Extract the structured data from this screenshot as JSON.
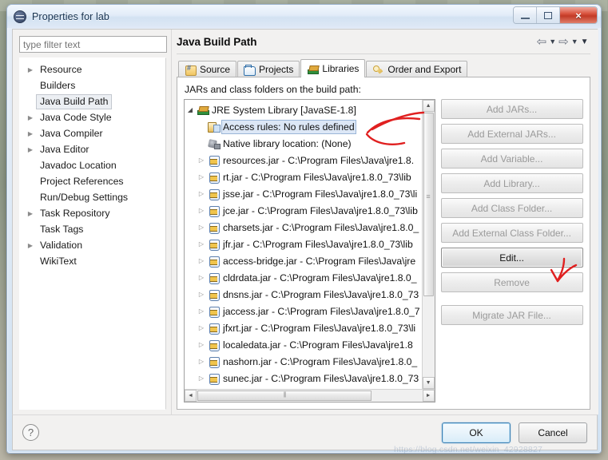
{
  "window": {
    "title": "Properties for lab",
    "logo_icon": "eclipse-logo",
    "controls": {
      "minimize": "minimize-icon",
      "maximize": "maximize-icon",
      "close": "×"
    }
  },
  "sidebar": {
    "filter": {
      "placeholder": "type filter text",
      "value": ""
    },
    "items": [
      {
        "label": "Resource",
        "expandable": true,
        "selected": false
      },
      {
        "label": "Builders",
        "expandable": false,
        "selected": false
      },
      {
        "label": "Java Build Path",
        "expandable": false,
        "selected": true
      },
      {
        "label": "Java Code Style",
        "expandable": true,
        "selected": false
      },
      {
        "label": "Java Compiler",
        "expandable": true,
        "selected": false
      },
      {
        "label": "Java Editor",
        "expandable": true,
        "selected": false
      },
      {
        "label": "Javadoc Location",
        "expandable": false,
        "selected": false
      },
      {
        "label": "Project References",
        "expandable": false,
        "selected": false
      },
      {
        "label": "Run/Debug Settings",
        "expandable": false,
        "selected": false
      },
      {
        "label": "Task Repository",
        "expandable": true,
        "selected": false
      },
      {
        "label": "Task Tags",
        "expandable": false,
        "selected": false
      },
      {
        "label": "Validation",
        "expandable": true,
        "selected": false
      },
      {
        "label": "WikiText",
        "expandable": false,
        "selected": false
      }
    ]
  },
  "page": {
    "title": "Java Build Path",
    "nav": {
      "back_icon": "arrow-left-icon",
      "back_menu_icon": "chevron-down-icon",
      "forward_icon": "arrow-right-icon",
      "forward_menu_icon": "chevron-down-icon",
      "menu_icon": "chevron-down-filled-icon"
    },
    "tabs": [
      {
        "label": "Source",
        "icon": "source-folder-icon",
        "active": false
      },
      {
        "label": "Projects",
        "icon": "project-folder-icon",
        "active": false
      },
      {
        "label": "Libraries",
        "icon": "libraries-icon",
        "active": true
      },
      {
        "label": "Order and Export",
        "icon": "order-export-icon",
        "active": false
      }
    ],
    "panel_label": "JARs and class folders on the build path:",
    "panel_label_mnemonic": "h"
  },
  "jar_tree": [
    {
      "label": "JRE System Library [JavaSE-1.8]",
      "icon": "jre-library-icon",
      "twisty": "expanded",
      "indent": 0,
      "selected": false
    },
    {
      "label": "Access rules: No rules defined",
      "icon": "access-rules-icon",
      "twisty": "none",
      "indent": 1,
      "selected": true
    },
    {
      "label": "Native library location: (None)",
      "icon": "native-library-icon",
      "twisty": "none",
      "indent": 1,
      "selected": false
    },
    {
      "label": "resources.jar - C:\\Program Files\\Java\\jre1.8.",
      "icon": "jar-icon",
      "twisty": "collapsed",
      "indent": 1,
      "selected": false
    },
    {
      "label": "rt.jar - C:\\Program Files\\Java\\jre1.8.0_73\\lib",
      "icon": "jar-icon",
      "twisty": "collapsed",
      "indent": 1,
      "selected": false
    },
    {
      "label": "jsse.jar - C:\\Program Files\\Java\\jre1.8.0_73\\li",
      "icon": "jar-icon",
      "twisty": "collapsed",
      "indent": 1,
      "selected": false
    },
    {
      "label": "jce.jar - C:\\Program Files\\Java\\jre1.8.0_73\\lib",
      "icon": "jar-icon",
      "twisty": "collapsed",
      "indent": 1,
      "selected": false
    },
    {
      "label": "charsets.jar - C:\\Program Files\\Java\\jre1.8.0_",
      "icon": "jar-icon",
      "twisty": "collapsed",
      "indent": 1,
      "selected": false
    },
    {
      "label": "jfr.jar - C:\\Program Files\\Java\\jre1.8.0_73\\lib",
      "icon": "jar-icon",
      "twisty": "collapsed",
      "indent": 1,
      "selected": false
    },
    {
      "label": "access-bridge.jar - C:\\Program Files\\Java\\jre",
      "icon": "jar-icon",
      "twisty": "collapsed",
      "indent": 1,
      "selected": false
    },
    {
      "label": "cldrdata.jar - C:\\Program Files\\Java\\jre1.8.0_",
      "icon": "jar-icon",
      "twisty": "collapsed",
      "indent": 1,
      "selected": false
    },
    {
      "label": "dnsns.jar - C:\\Program Files\\Java\\jre1.8.0_73",
      "icon": "jar-icon",
      "twisty": "collapsed",
      "indent": 1,
      "selected": false
    },
    {
      "label": "jaccess.jar - C:\\Program Files\\Java\\jre1.8.0_7",
      "icon": "jar-icon",
      "twisty": "collapsed",
      "indent": 1,
      "selected": false
    },
    {
      "label": "jfxrt.jar - C:\\Program Files\\Java\\jre1.8.0_73\\li",
      "icon": "jar-icon",
      "twisty": "collapsed",
      "indent": 1,
      "selected": false
    },
    {
      "label": "localedata.jar - C:\\Program Files\\Java\\jre1.8",
      "icon": "jar-icon",
      "twisty": "collapsed",
      "indent": 1,
      "selected": false
    },
    {
      "label": "nashorn.jar - C:\\Program Files\\Java\\jre1.8.0_",
      "icon": "jar-icon",
      "twisty": "collapsed",
      "indent": 1,
      "selected": false
    },
    {
      "label": "sunec.jar - C:\\Program Files\\Java\\jre1.8.0_73",
      "icon": "jar-icon",
      "twisty": "collapsed",
      "indent": 1,
      "selected": false
    }
  ],
  "side_buttons": [
    {
      "label": "Add JARs...",
      "enabled": false
    },
    {
      "label": "Add External JARs...",
      "enabled": false
    },
    {
      "label": "Add Variable...",
      "enabled": false
    },
    {
      "label": "Add Library...",
      "enabled": false
    },
    {
      "label": "Add Class Folder...",
      "enabled": false
    },
    {
      "label": "Add External Class Folder...",
      "enabled": false
    },
    {
      "label": "Edit...",
      "enabled": true
    },
    {
      "label": "Remove",
      "enabled": false
    },
    {
      "label": "Migrate JAR File...",
      "enabled": false
    }
  ],
  "footer": {
    "help_icon": "question-mark-icon",
    "ok_label": "OK",
    "cancel_label": "Cancel"
  },
  "watermark": "https://blog.csdn.net/weixin_42928827",
  "colors": {
    "selection": "#dce7f6",
    "annotation": "#e02020",
    "title_text": "#15314f",
    "close_button": "#c23a26"
  }
}
